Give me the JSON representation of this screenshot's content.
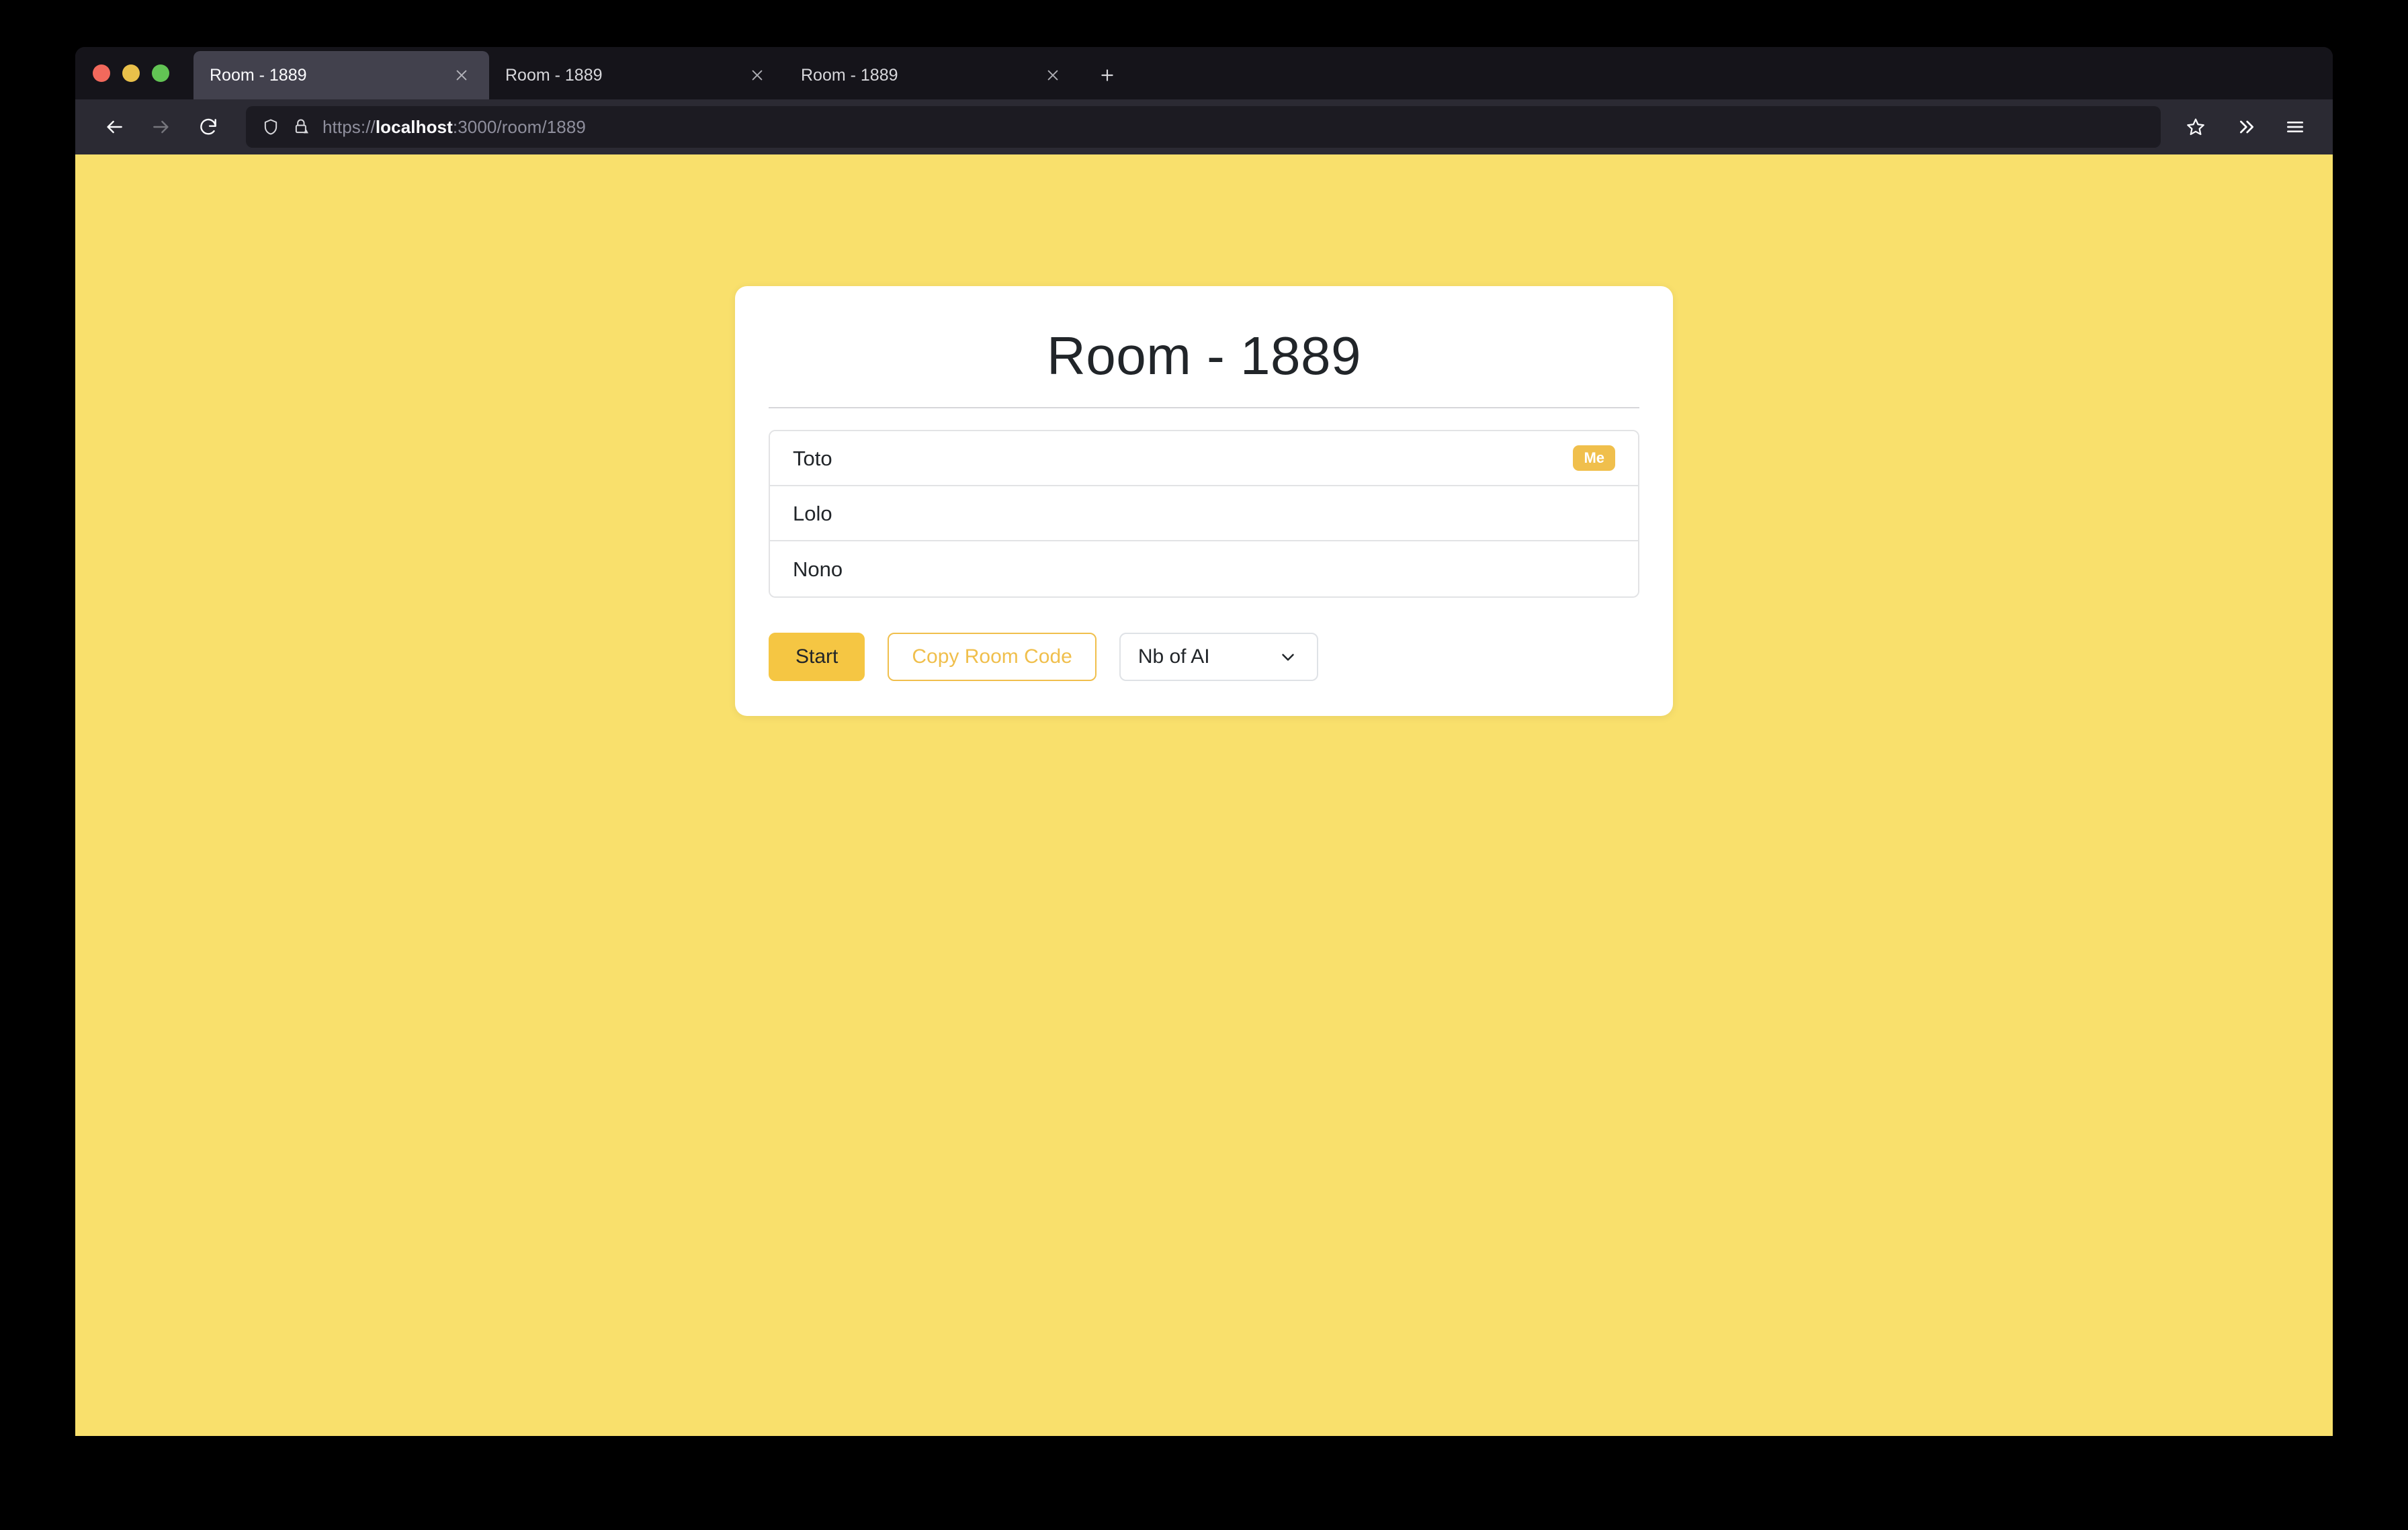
{
  "browser": {
    "traffic_lights": [
      "close",
      "minimize",
      "maximize"
    ],
    "tabs": [
      {
        "title": "Room - 1889",
        "active": true
      },
      {
        "title": "Room - 1889",
        "active": false
      },
      {
        "title": "Room - 1889",
        "active": false
      }
    ],
    "new_tab_label": "+",
    "nav": {
      "back": "back-arrow",
      "forward": "forward-arrow",
      "reload": "reload"
    },
    "url": {
      "scheme": "https://",
      "host": "localhost",
      "path": ":3000/room/1889",
      "full": "https://localhost:3000/room/1889",
      "shield_icon": "shield-icon",
      "lock_warning_icon": "lock-warning-icon"
    },
    "toolbar_right": {
      "bookmark": "star-icon",
      "overflow": "double-chevron-icon",
      "menu": "hamburger-icon"
    }
  },
  "page": {
    "background_color": "#f9e06c",
    "card": {
      "title": "Room - 1889",
      "players": [
        {
          "name": "Toto",
          "badge": "Me"
        },
        {
          "name": "Lolo",
          "badge": null
        },
        {
          "name": "Nono",
          "badge": null
        }
      ],
      "actions": {
        "start_label": "Start",
        "copy_room_code_label": "Copy Room Code",
        "nb_of_ai_label": "Nb of AI"
      },
      "colors": {
        "accent": "#f5c643",
        "badge": "#f0bf4c",
        "outline_button_text": "#f0bf4c"
      }
    }
  }
}
